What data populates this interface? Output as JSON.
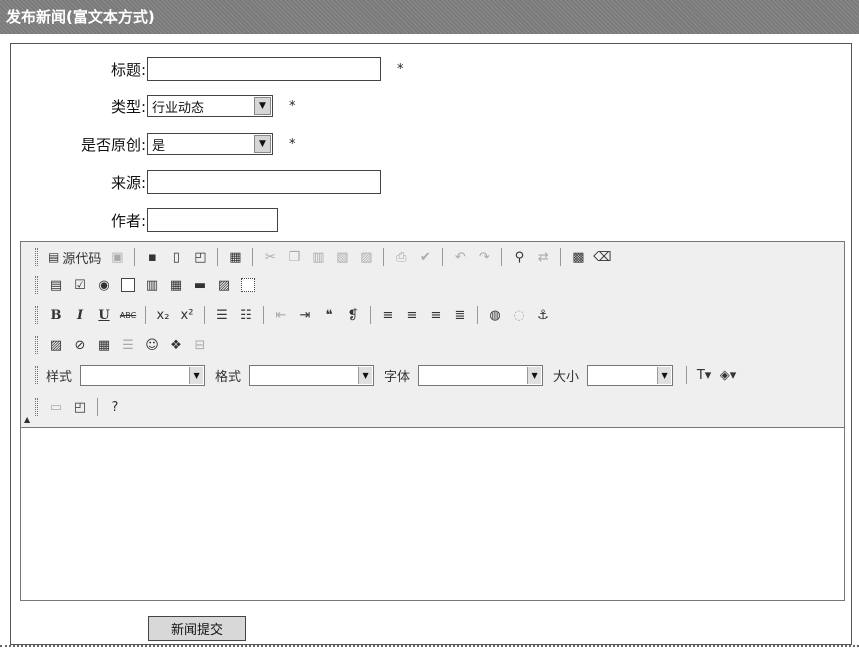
{
  "header": {
    "title": "发布新闻(富文本方式)"
  },
  "form": {
    "title_label": "标题:",
    "type_label": "类型:",
    "type_value": "行业动态",
    "original_label": "是否原创:",
    "original_value": "是",
    "source_label": "来源:",
    "author_label": "作者:",
    "required_mark": "*",
    "title_value": "",
    "source_value": "",
    "author_value": ""
  },
  "editor": {
    "source_label": "源代码",
    "style_label": "样式",
    "format_label": "格式",
    "font_label": "字体",
    "size_label": "大小",
    "bold": "B",
    "italic": "I",
    "underline": "U",
    "strike": "ABC",
    "content": ""
  },
  "submit_label": "新闻提交"
}
